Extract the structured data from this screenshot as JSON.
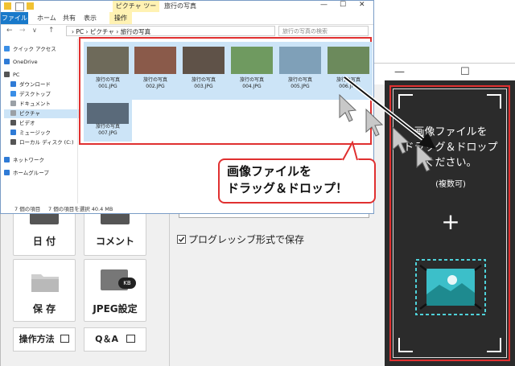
{
  "explorer": {
    "tool_tab": "ピクチャ ツール",
    "title": "旅行の写真",
    "menu": {
      "file": "ファイル",
      "home": "ホーム",
      "share": "共有",
      "view": "表示",
      "manage": "操作"
    },
    "address": "›  PC  ›  ピクチャ  ›  旅行の写真",
    "search_placeholder": "旅行の写真の検索",
    "nav": [
      {
        "label": "クイック アクセス",
        "color": "#3a8ee6"
      },
      {
        "label": "OneDrive",
        "color": "#2f7bd6"
      },
      {
        "label": "PC",
        "color": "#555555"
      },
      {
        "label": "ダウンロード",
        "color": "#2f7bd6"
      },
      {
        "label": "デスクトップ",
        "color": "#3a8ee6"
      },
      {
        "label": "ドキュメント",
        "color": "#9aa0a6"
      },
      {
        "label": "ピクチャ",
        "color": "#9aa0a6"
      },
      {
        "label": "ビデオ",
        "color": "#555555"
      },
      {
        "label": "ミュージック",
        "color": "#2f7bd6"
      },
      {
        "label": "ローカル ディスク (C:)",
        "color": "#555555"
      },
      {
        "label": "ネットワーク",
        "color": "#2f7bd6"
      },
      {
        "label": "ホームグループ",
        "color": "#2f7bd6"
      }
    ],
    "status_count": "7 個の項目",
    "status_selected": "7 個の項目を選択  40.4 MB",
    "photos": [
      {
        "name": "旅行の写真",
        "file": "001.JPG",
        "color": "#6e6a5a"
      },
      {
        "name": "旅行の写真",
        "file": "002.JPG",
        "color": "#8a5a4a"
      },
      {
        "name": "旅行の写真",
        "file": "003.JPG",
        "color": "#5f5248"
      },
      {
        "name": "旅行の写真",
        "file": "004.JPG",
        "color": "#6f9a60"
      },
      {
        "name": "旅行の写真",
        "file": "005.JPG",
        "color": "#7fa0b8"
      },
      {
        "name": "旅行の写真",
        "file": "006.JPG",
        "color": "#6c8a5c"
      },
      {
        "name": "旅行の写真",
        "file": "007.JPG",
        "color": "#5a6a7a"
      }
    ]
  },
  "callout": {
    "line1": "画像ファイルを",
    "line2": "ドラッグ＆ドロップ！"
  },
  "dropzone": {
    "line1": "画像ファイルを",
    "line2": "ドラッグ＆ドロップ",
    "line3": "ください。",
    "sub": "(複数可)",
    "plus": "+",
    "close": "✕",
    "minimize": "—",
    "maximize": "☐"
  },
  "app": {
    "date_label": "日 付",
    "comment_label": "コメント",
    "save_label": "保 存",
    "jpeg_label": "JPEG設定",
    "howto_label": "操作方法",
    "qa_label": "Q＆A",
    "progressive_label": "プログレッシブ形式で保存"
  }
}
